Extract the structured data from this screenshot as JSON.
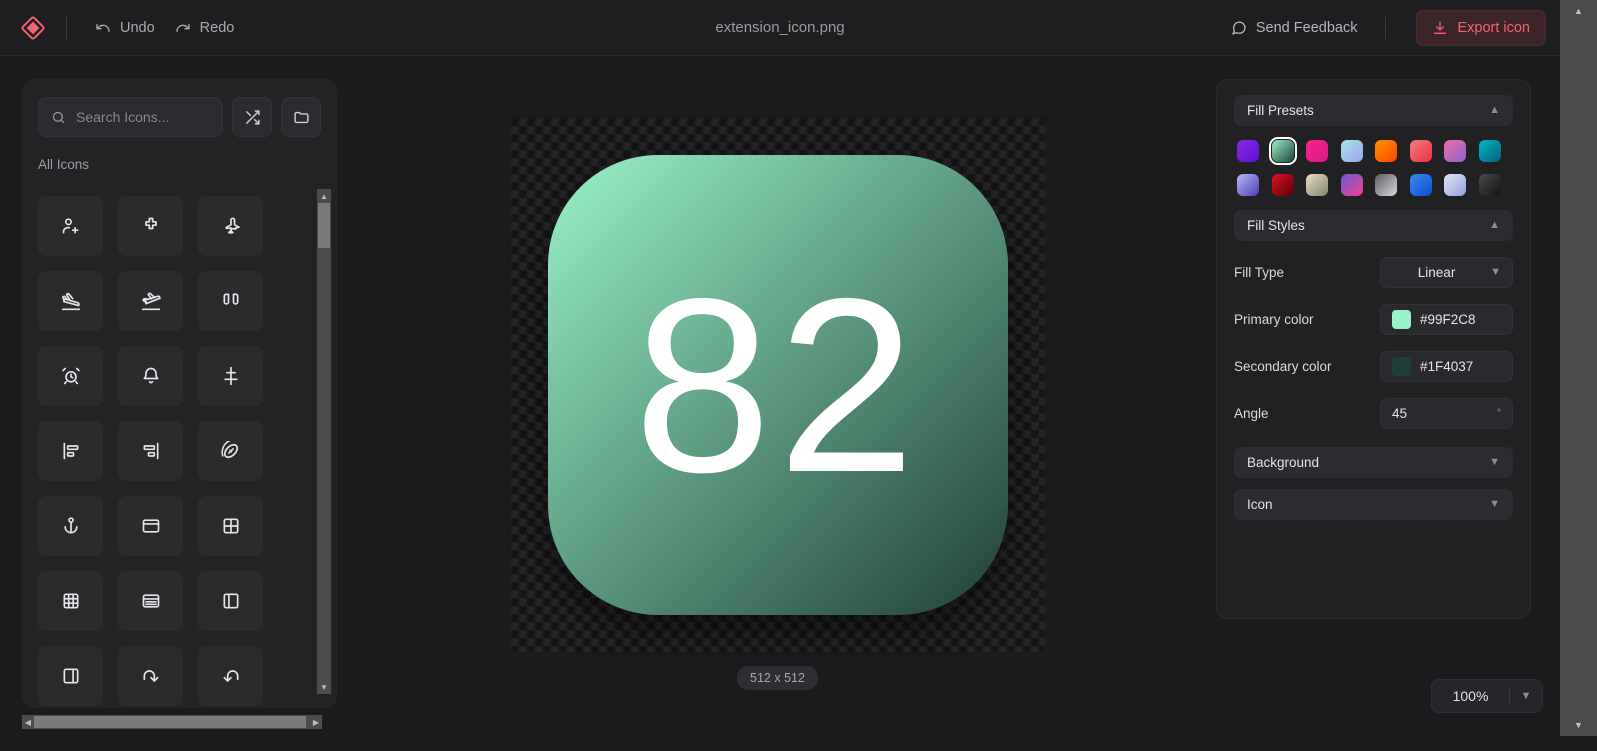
{
  "topbar": {
    "logo_name": "diamond-logo",
    "undo_label": "Undo",
    "redo_label": "Redo",
    "title": "extension_icon.png",
    "feedback_label": "Send Feedback",
    "export_label": "Export icon",
    "accent_color": "#ef6470"
  },
  "sidebar": {
    "search_placeholder": "Search Icons...",
    "search_value": "",
    "shuffle_button_name": "shuffle-icon",
    "folder_button_name": "folder-icon",
    "section_label": "All Icons",
    "icons": [
      {
        "name": "user-plus-icon"
      },
      {
        "name": "air-vent-icon"
      },
      {
        "name": "airplane-icon"
      },
      {
        "name": "plane-landing-icon"
      },
      {
        "name": "plane-takeoff-icon"
      },
      {
        "name": "airpods-icon"
      },
      {
        "name": "alarm-clock-icon"
      },
      {
        "name": "bell-ring-icon"
      },
      {
        "name": "align-center-vertical-icon"
      },
      {
        "name": "align-horizontal-left-icon"
      },
      {
        "name": "align-horizontal-right-icon"
      },
      {
        "name": "american-football-icon"
      },
      {
        "name": "anchor-icon"
      },
      {
        "name": "app-window-icon"
      },
      {
        "name": "layout-grid-icon"
      },
      {
        "name": "layout-dashboard-icon"
      },
      {
        "name": "layout-list-icon"
      },
      {
        "name": "panel-left-icon"
      },
      {
        "name": "panel-right-icon"
      },
      {
        "name": "redo-arrow-icon"
      },
      {
        "name": "undo-arrow-icon"
      }
    ]
  },
  "canvas": {
    "icon_glyph": "82",
    "icon_glyph_color": "#FFFFFF",
    "gradient_primary": "#99F2C8",
    "gradient_secondary": "#1F4037",
    "gradient_angle": 45,
    "size_label": "512 x 512",
    "zoom_value": "100%"
  },
  "inspector": {
    "fill_presets": {
      "title": "Fill Presets",
      "expanded": true,
      "swatches": [
        {
          "name": "preset-violet",
          "from": "#8A2BE2",
          "to": "#5B0FD6",
          "selected": false
        },
        {
          "name": "preset-green",
          "from": "#99F2C8",
          "to": "#1F4037",
          "selected": true
        },
        {
          "name": "preset-magenta",
          "from": "#F72585",
          "to": "#D81B8C",
          "selected": false
        },
        {
          "name": "preset-sky",
          "from": "#A6E3F0",
          "to": "#9AA6E8",
          "selected": false
        },
        {
          "name": "preset-orange",
          "from": "#FF9500",
          "to": "#FF4500",
          "selected": false
        },
        {
          "name": "preset-coral",
          "from": "#F08080",
          "to": "#E8303F",
          "selected": false
        },
        {
          "name": "preset-pink-purple",
          "from": "#F06EA9",
          "to": "#8E63C8",
          "selected": false
        },
        {
          "name": "preset-teal",
          "from": "#00B8C4",
          "to": "#0A5E7A",
          "selected": false
        },
        {
          "name": "preset-periwinkle",
          "from": "#B7B9F2",
          "to": "#4A3FBF",
          "selected": false
        },
        {
          "name": "preset-crimson",
          "from": "#E01020",
          "to": "#5A0008",
          "selected": false
        },
        {
          "name": "preset-sand",
          "from": "#E8E0C0",
          "to": "#7F8470",
          "selected": false
        },
        {
          "name": "preset-indigo-pink",
          "from": "#6A5ACD",
          "to": "#F0409A",
          "selected": false
        },
        {
          "name": "preset-silver",
          "from": "#5C5C63",
          "to": "#D6D8DE",
          "selected": false
        },
        {
          "name": "preset-blue",
          "from": "#3B8CF0",
          "to": "#0A4FD0",
          "selected": false
        },
        {
          "name": "preset-lavender",
          "from": "#DDE3F5",
          "to": "#93A3DC",
          "selected": false
        },
        {
          "name": "preset-charcoal",
          "from": "#4A4A4E",
          "to": "#141416",
          "selected": false
        }
      ]
    },
    "fill_styles": {
      "title": "Fill Styles",
      "expanded": true,
      "fill_type_label": "Fill Type",
      "fill_type_value": "Linear",
      "primary_label": "Primary color",
      "primary_value": "#99F2C8",
      "secondary_label": "Secondary color",
      "secondary_value": "#1F4037",
      "angle_label": "Angle",
      "angle_value": "45",
      "angle_unit": "°"
    },
    "background": {
      "title": "Background",
      "expanded": false
    },
    "icon": {
      "title": "Icon",
      "expanded": false
    }
  }
}
